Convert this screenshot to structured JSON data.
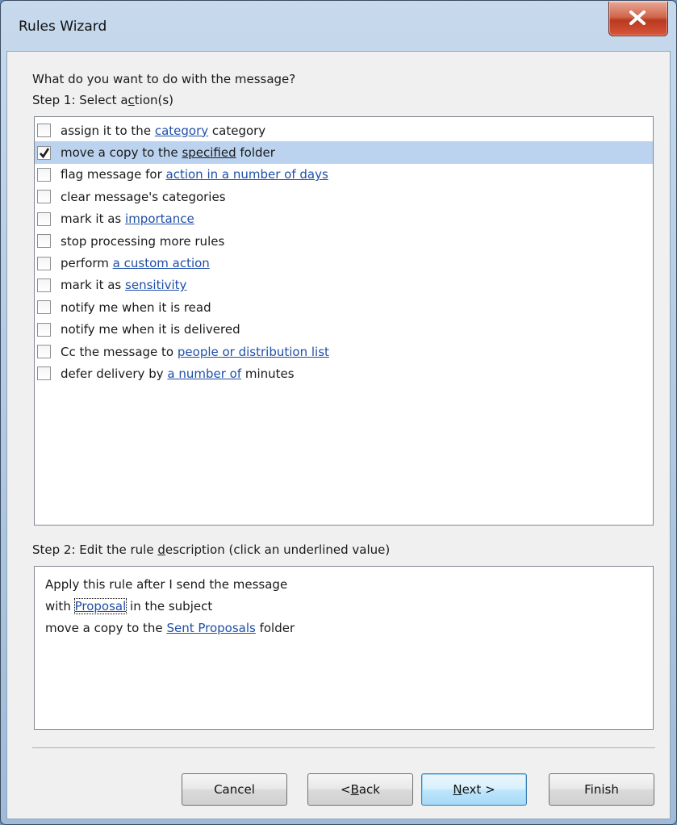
{
  "window": {
    "title": "Rules Wizard"
  },
  "prompt": "What do you want to do with the message?",
  "step1": {
    "before": "Step 1: Select a",
    "key": "c",
    "after": "tion(s)"
  },
  "actions": [
    {
      "checked": false,
      "selected": false,
      "pre": "assign it to the ",
      "link": "category",
      "post": " category"
    },
    {
      "checked": true,
      "selected": true,
      "pre": "move a copy to the ",
      "link": "specified",
      "post": " folder"
    },
    {
      "checked": false,
      "selected": false,
      "pre": "flag message for ",
      "link": "action in a number of days",
      "post": ""
    },
    {
      "checked": false,
      "selected": false,
      "pre": "clear message's categories",
      "link": "",
      "post": ""
    },
    {
      "checked": false,
      "selected": false,
      "pre": "mark it as ",
      "link": "importance",
      "post": ""
    },
    {
      "checked": false,
      "selected": false,
      "pre": "stop processing more rules",
      "link": "",
      "post": ""
    },
    {
      "checked": false,
      "selected": false,
      "pre": "perform ",
      "link": "a custom action",
      "post": ""
    },
    {
      "checked": false,
      "selected": false,
      "pre": "mark it as ",
      "link": "sensitivity",
      "post": ""
    },
    {
      "checked": false,
      "selected": false,
      "pre": "notify me when it is read",
      "link": "",
      "post": ""
    },
    {
      "checked": false,
      "selected": false,
      "pre": "notify me when it is delivered",
      "link": "",
      "post": ""
    },
    {
      "checked": false,
      "selected": false,
      "pre": "Cc the message to ",
      "link": "people or distribution list",
      "post": ""
    },
    {
      "checked": false,
      "selected": false,
      "pre": "defer delivery by ",
      "link": "a number of",
      "post": " minutes"
    }
  ],
  "step2": {
    "before": "Step 2: Edit the rule ",
    "key": "d",
    "after": "escription (click an underlined value)"
  },
  "description": {
    "line1": "Apply this rule after I send the message",
    "line2_pre": "with ",
    "line2_link": "Proposal",
    "line2_post": " in the subject",
    "line3_pre": "move a copy to the ",
    "line3_link": "Sent Proposals",
    "line3_post": " folder"
  },
  "buttons": {
    "cancel": "Cancel",
    "back": {
      "pre": "< ",
      "key": "B",
      "post": "ack"
    },
    "next": {
      "key": "N",
      "post": "ext >"
    },
    "finish": "Finish"
  },
  "colors": {
    "link": "#1f4fa8",
    "selected_row": "#bcd3ef",
    "close_button": "#c9462b"
  }
}
